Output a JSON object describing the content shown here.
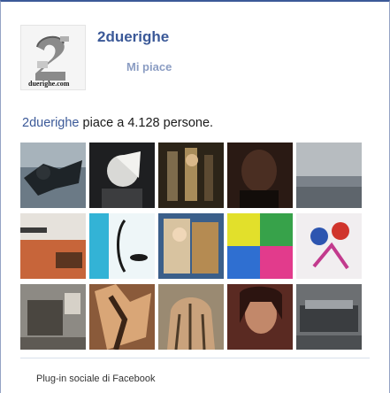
{
  "page": {
    "name": "2duerighe",
    "logo_text": "duerighe.com"
  },
  "like_button": {
    "label": "Mi piace"
  },
  "likes": {
    "link_text": "2duerighe",
    "text": " piace a 4.128 persone."
  },
  "footer": {
    "text": "Plug-in sociale di Facebook"
  },
  "colors": {
    "facebook_blue": "#3b5998",
    "like_label": "#8b9dc3",
    "border": "#94a3c4"
  }
}
